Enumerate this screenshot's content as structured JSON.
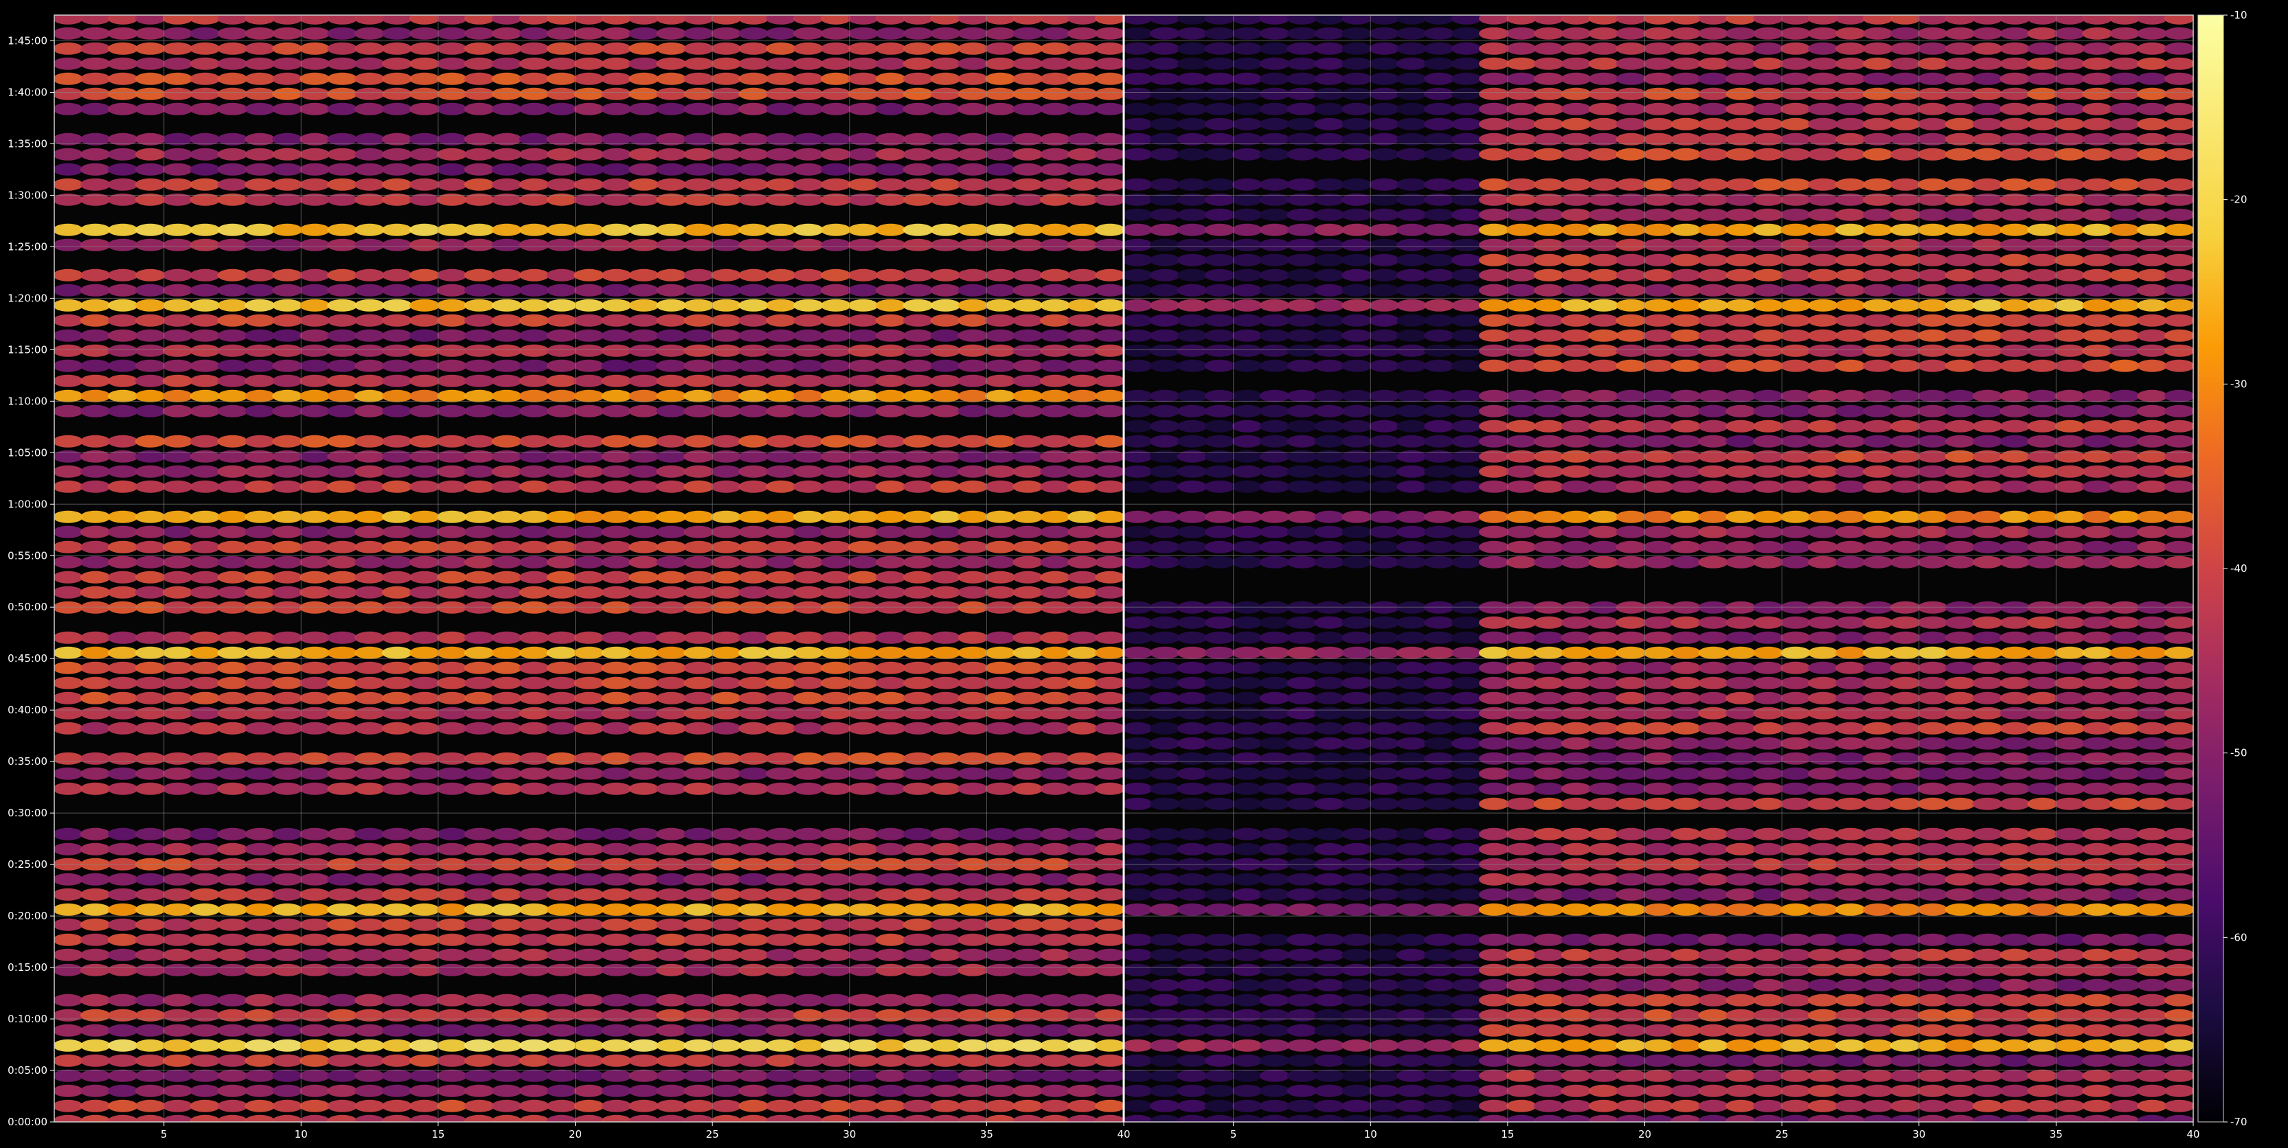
{
  "chart_data": [
    {
      "type": "heatmap",
      "title": "",
      "xlabel": "",
      "ylabel": "",
      "xlim": [
        1,
        40
      ],
      "x_ticks": [
        "5",
        "10",
        "15",
        "20",
        "25",
        "30",
        "35",
        "40"
      ],
      "x_tick_values": [
        5,
        10,
        15,
        20,
        25,
        30,
        35,
        40
      ],
      "y_ticks": [
        "0:00:00",
        "0:05:00",
        "0:10:00",
        "0:15:00",
        "0:20:00",
        "0:25:00",
        "0:30:00",
        "0:35:00",
        "0:40:00",
        "0:45:00",
        "0:50:00",
        "0:55:00",
        "1:00:00",
        "1:05:00",
        "1:10:00",
        "1:15:00",
        "1:20:00",
        "1:25:00",
        "1:30:00",
        "1:35:00",
        "1:40:00",
        "1:45:00"
      ],
      "y_tick_seconds": [
        0,
        300,
        600,
        900,
        1200,
        1500,
        1800,
        2100,
        2400,
        2700,
        3000,
        3300,
        3600,
        3900,
        4200,
        4500,
        4800,
        5100,
        5400,
        5700,
        6000,
        6300
      ],
      "ylim_seconds": [
        0,
        6450
      ],
      "grid": true,
      "strong_bands": [
        {
          "start_s": 360,
          "end_s": 460,
          "value": -24
        },
        {
          "start_s": 1200,
          "end_s": 1300,
          "value": -29
        },
        {
          "start_s": 2680,
          "end_s": 2780,
          "value": -26
        },
        {
          "start_s": 3480,
          "end_s": 3580,
          "value": -29
        },
        {
          "start_s": 4180,
          "end_s": 4260,
          "value": -30
        },
        {
          "start_s": 4740,
          "end_s": 4830,
          "value": -26
        },
        {
          "start_s": 5120,
          "end_s": 5220,
          "value": -27
        }
      ]
    },
    {
      "type": "heatmap",
      "title": "",
      "xlabel": "",
      "ylabel": "",
      "xlim": [
        1,
        40
      ],
      "x_ticks": [
        "5",
        "10",
        "15",
        "20",
        "25",
        "30",
        "35",
        "40"
      ],
      "x_tick_values": [
        5,
        10,
        15,
        20,
        25,
        30,
        35,
        40
      ],
      "grid": true,
      "quiet_region": {
        "x_from": 1,
        "x_to": 14,
        "value": -65
      },
      "strong_bands": [
        {
          "start_s": 360,
          "end_s": 460,
          "value": -27
        },
        {
          "start_s": 1200,
          "end_s": 1300,
          "value": -32
        },
        {
          "start_s": 2680,
          "end_s": 2780,
          "value": -29
        },
        {
          "start_s": 3480,
          "end_s": 3580,
          "value": -31
        },
        {
          "start_s": 4740,
          "end_s": 4830,
          "value": -28
        },
        {
          "start_s": 5120,
          "end_s": 5220,
          "value": -30
        }
      ]
    }
  ],
  "colorbar": {
    "colormap": "inferno",
    "vmin": -70,
    "vmax": -10,
    "ticks": [
      "-10",
      "-20",
      "-30",
      "-40",
      "-50",
      "-60",
      "-70"
    ],
    "tick_values": [
      -10,
      -20,
      -30,
      -40,
      -50,
      -60,
      -70
    ]
  },
  "colors": {
    "background": "#000000",
    "axes_face": "#050505",
    "grid": "#888888",
    "text": "#ffffff"
  }
}
